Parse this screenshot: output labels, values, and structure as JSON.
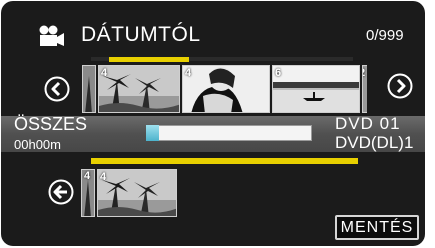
{
  "header": {
    "title": "DÁTUMTÓL",
    "counter": "0/999",
    "icon": "video-camera-icon"
  },
  "top_strip": {
    "thumbnails": [
      {
        "label": "4"
      },
      {
        "label": "4"
      },
      {
        "label": "6"
      },
      {
        "label": "2"
      }
    ],
    "prev_icon": "chevron-left-icon",
    "next_icon": "chevron-right-icon"
  },
  "info": {
    "all_label": "ÖSSZES",
    "duration": "00h00m",
    "disc_type": "DVD  01",
    "disc_type2": "DVD(DL)1",
    "capacity_used": 0.08
  },
  "bottom_strip": {
    "thumbnails": [
      {
        "label": "4"
      },
      {
        "label": "4"
      }
    ],
    "back_icon": "arrow-left-icon"
  },
  "save_button": {
    "label": "MENTÉS"
  },
  "colors": {
    "accent": "#e8d000",
    "capacity": "#5ec2d8",
    "background": "#1b1b1b"
  }
}
